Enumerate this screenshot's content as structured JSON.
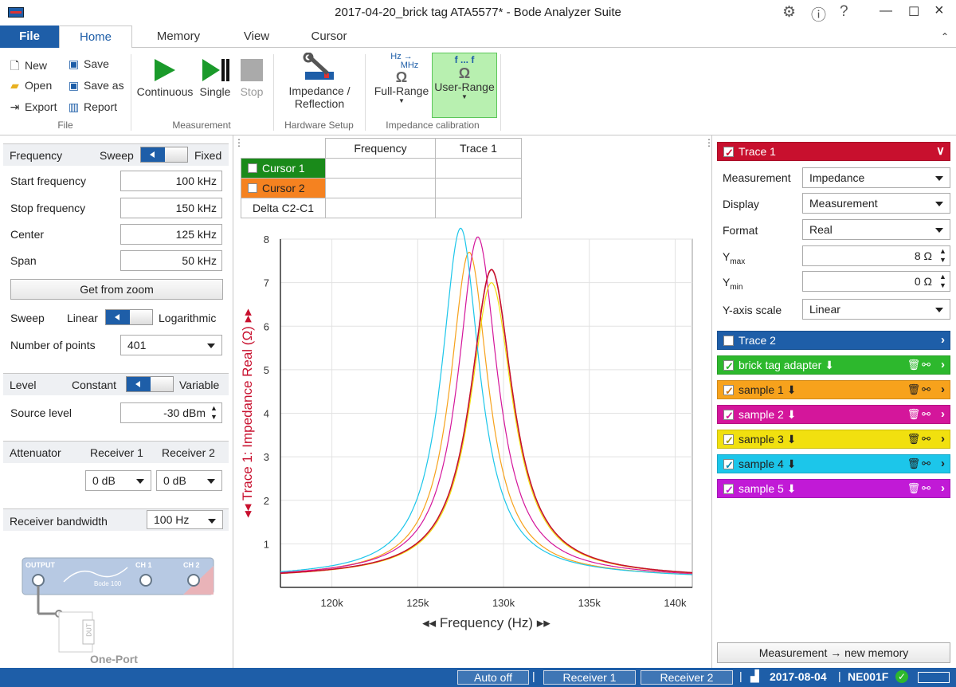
{
  "window": {
    "title": "2017-04-20_brick tag ATA5577* - Bode Analyzer Suite"
  },
  "tabs": [
    "File",
    "Home",
    "Memory",
    "View",
    "Cursor"
  ],
  "ribbon": {
    "file": {
      "new": "New",
      "open": "Open",
      "export": "Export",
      "save": "Save",
      "save_as": "Save as",
      "report": "Report",
      "group": "File"
    },
    "measurement": {
      "continuous": "Continuous",
      "single": "Single",
      "stop": "Stop",
      "group": "Measurement"
    },
    "hardware": {
      "line1": "Impedance /",
      "line2": "Reflection",
      "group": "Hardware Setup"
    },
    "calibration": {
      "full_range": "Full-Range",
      "user_range": "User-Range",
      "group": "Impedance calibration",
      "hz_top": "Hz →",
      "hz_bottom": "MHz",
      "user_top": "f ... f"
    }
  },
  "frequency": {
    "title": "Frequency",
    "sweep_label": "Sweep",
    "fixed_label": "Fixed",
    "start_label": "Start frequency",
    "start": "100 kHz",
    "stop_label": "Stop frequency",
    "stop": "150 kHz",
    "center_label": "Center",
    "center": "125 kHz",
    "span_label": "Span",
    "span": "50 kHz",
    "get_zoom": "Get from zoom",
    "sweep_type_label": "Sweep",
    "linear": "Linear",
    "log": "Logarithmic",
    "points_label": "Number of points",
    "points": "401"
  },
  "level": {
    "title": "Level",
    "constant": "Constant",
    "variable": "Variable",
    "source_label": "Source level",
    "source": "-30 dBm"
  },
  "attenuator": {
    "title": "Attenuator",
    "r1": "Receiver 1",
    "r2": "Receiver 2",
    "r1_val": "0 dB",
    "r2_val": "0 dB"
  },
  "bandwidth": {
    "title": "Receiver bandwidth",
    "value": "100 Hz"
  },
  "diagram": {
    "output": "OUTPUT",
    "ch1": "CH 1",
    "ch2": "CH 2",
    "device": "Bode 100",
    "dut": "DUT",
    "mode": "One-Port"
  },
  "cursor_table": {
    "headers": [
      "Frequency",
      "Trace 1"
    ],
    "rows": [
      "Cursor 1",
      "Cursor 2",
      "Delta C2-C1"
    ]
  },
  "right": {
    "trace1": "Trace 1",
    "measurement_label": "Measurement",
    "measurement": "Impedance",
    "display_label": "Display",
    "display": "Measurement",
    "format_label": "Format",
    "format": "Real",
    "ymax_label": "Y",
    "ymax_sub": "max",
    "ymax": "8 Ω",
    "ymin_label": "Y",
    "ymin_sub": "min",
    "ymin": "0 Ω",
    "yscale_label": "Y-axis scale",
    "yscale": "Linear",
    "trace2": "Trace 2",
    "memories": [
      "brick tag adapter",
      "sample 1",
      "sample 2",
      "sample 3",
      "sample 4",
      "sample 5"
    ],
    "new_memory": "Measurement → new memory"
  },
  "status": {
    "auto": "Auto off",
    "r1": "Receiver 1",
    "r2": "Receiver 2",
    "date": "2017-08-04",
    "device": "NE001F"
  },
  "colors": {
    "accent": "#1e5ea8",
    "trace1": "#c8102e",
    "trace2": "#1e5ea8",
    "adapter": "#2db82d",
    "s1": "#f7a21c",
    "s2": "#d4169b",
    "s3": "#f1e00f",
    "s4": "#1cc6ea",
    "s5": "#c11ad6"
  },
  "chart_data": {
    "type": "line",
    "xlabel": "Frequency (Hz)",
    "ylabel": "Trace 1: Impedance Real (Ω)",
    "xlim": [
      117000,
      141000
    ],
    "ylim": [
      0,
      8
    ],
    "xticks": [
      "120k",
      "125k",
      "130k",
      "135k",
      "140k"
    ],
    "yticks": [
      1,
      2,
      3,
      4,
      5,
      6,
      7,
      8
    ],
    "series": [
      {
        "name": "Trace 1",
        "color": "#c8102e",
        "f0": 129300,
        "peak": 7.0,
        "gamma": 1500
      },
      {
        "name": "brick tag adapter",
        "color": "#2db82d",
        "f0": 129300,
        "peak": 7.0,
        "gamma": 1500
      },
      {
        "name": "sample 1",
        "color": "#f7a21c",
        "f0": 128000,
        "peak": 7.4,
        "gamma": 1350
      },
      {
        "name": "sample 2",
        "color": "#d4169b",
        "f0": 128500,
        "peak": 7.75,
        "gamma": 1400
      },
      {
        "name": "sample 3",
        "color": "#f1e00f",
        "f0": 129300,
        "peak": 6.7,
        "gamma": 1500
      },
      {
        "name": "sample 4",
        "color": "#1cc6ea",
        "f0": 127500,
        "peak": 7.95,
        "gamma": 1350
      },
      {
        "name": "sample 5",
        "color": "#c11ad6",
        "f0": 129300,
        "peak": 7.0,
        "gamma": 1500
      }
    ]
  }
}
